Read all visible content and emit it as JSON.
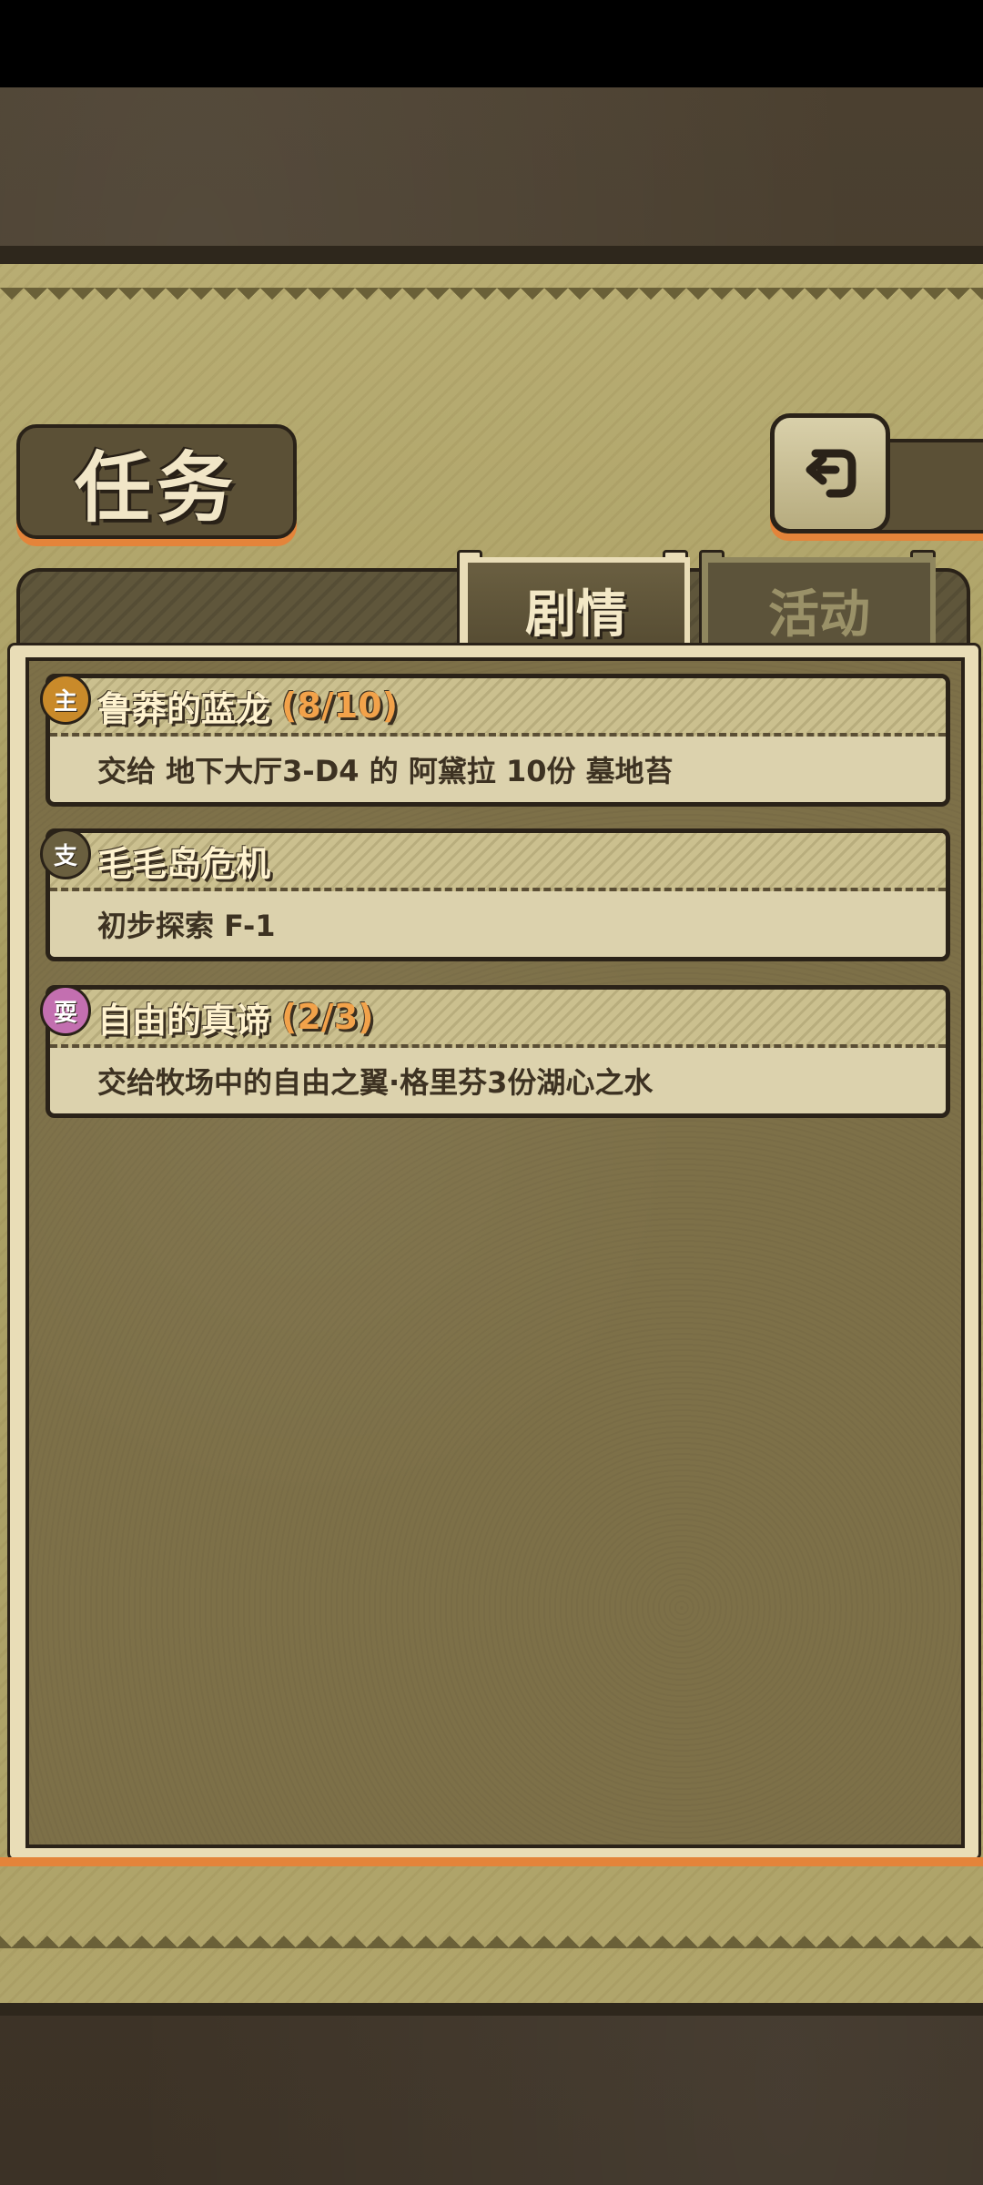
{
  "header": {
    "title": "任务"
  },
  "tabs": [
    {
      "label": "剧情",
      "active": true
    },
    {
      "label": "活动",
      "active": false
    }
  ],
  "quests": [
    {
      "badge": "主",
      "badge_color": "#c98a2a",
      "name": "鲁莽的蓝龙",
      "progress": "(8/10)",
      "description": "交给 地下大厅3-D4 的 阿黛拉 10份 墓地苔"
    },
    {
      "badge": "支",
      "badge_color": "#6a5f3f",
      "name": "毛毛岛危机",
      "progress": "",
      "description": "初步探索 F-1"
    },
    {
      "badge": "耍",
      "badge_color": "#c36fb0",
      "name": "自由的真谛",
      "progress": "(2/3)",
      "description": "交给牧场中的自由之翼·格里芬3份湖心之水"
    }
  ],
  "icons": {
    "back": "back-arrow-icon"
  },
  "colors": {
    "accent_orange": "#e4843a",
    "parchment": "#d8cda6",
    "panel": "#7d7048"
  }
}
